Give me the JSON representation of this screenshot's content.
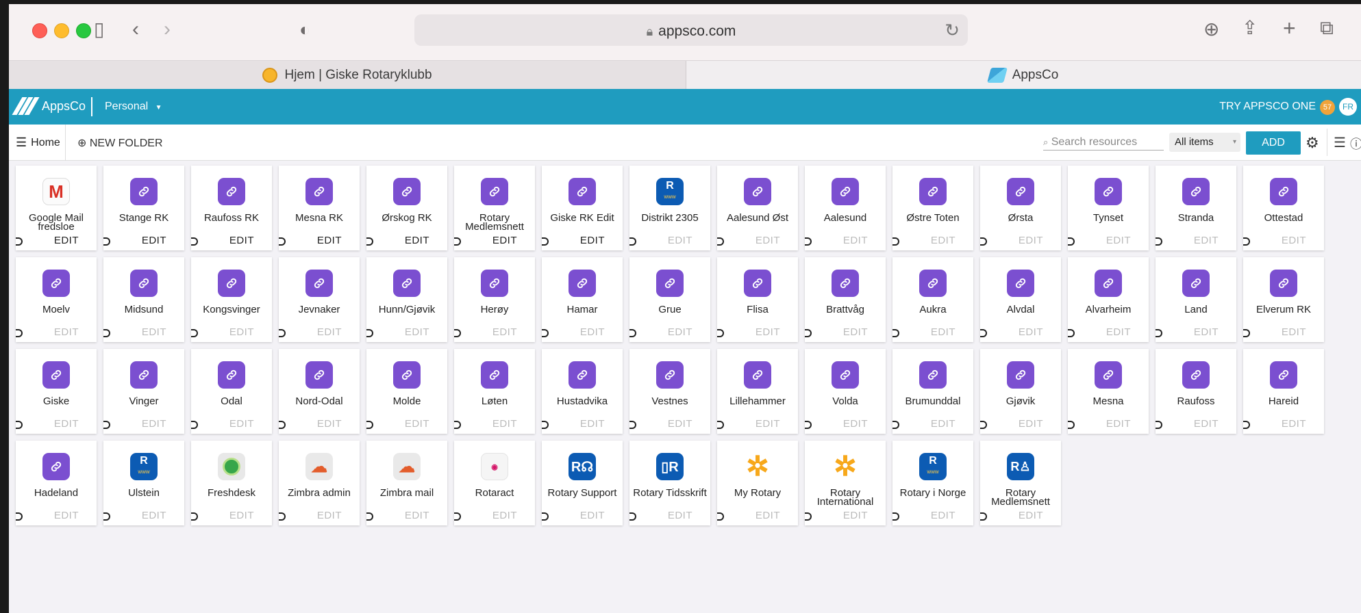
{
  "browser": {
    "url": "appsco.com",
    "tabs": [
      {
        "label": "Hjem | Giske Rotaryklubb"
      },
      {
        "label": "AppsCo"
      }
    ]
  },
  "header": {
    "logo_text": "AppsCo",
    "workspace": "Personal",
    "try_label": "TRY APPSCO ONE",
    "notification_count": "57",
    "avatar_initials": "FR",
    "brand_color": "#1f9cbf"
  },
  "toolbar": {
    "home_label": "Home",
    "new_folder_label": "NEW FOLDER",
    "search_placeholder": "Search resources",
    "filter_value": "All items",
    "add_label": "ADD"
  },
  "resources": [
    {
      "name": "Google Mail fredsloe",
      "icon": "gmail",
      "edit": "EDIT",
      "editable": true
    },
    {
      "name": "Stange RK",
      "icon": "link",
      "edit": "EDIT",
      "editable": true
    },
    {
      "name": "Raufoss RK",
      "icon": "link",
      "edit": "EDIT",
      "editable": true
    },
    {
      "name": "Mesna RK",
      "icon": "link",
      "edit": "EDIT",
      "editable": true
    },
    {
      "name": "Ørskog RK",
      "icon": "link",
      "edit": "EDIT",
      "editable": true
    },
    {
      "name": "Rotary Medlemsnett",
      "icon": "link",
      "edit": "EDIT",
      "editable": true
    },
    {
      "name": "Giske RK Edit",
      "icon": "link",
      "edit": "EDIT",
      "editable": true
    },
    {
      "name": "Distrikt 2305",
      "icon": "rwww",
      "edit": "EDIT",
      "editable": false
    },
    {
      "name": "Aalesund Øst",
      "icon": "link",
      "edit": "EDIT",
      "editable": false
    },
    {
      "name": "Aalesund",
      "icon": "link",
      "edit": "EDIT",
      "editable": false
    },
    {
      "name": "Østre Toten",
      "icon": "link",
      "edit": "EDIT",
      "editable": false
    },
    {
      "name": "Ørsta",
      "icon": "link",
      "edit": "EDIT",
      "editable": false
    },
    {
      "name": "Tynset",
      "icon": "link",
      "edit": "EDIT",
      "editable": false
    },
    {
      "name": "Stranda",
      "icon": "link",
      "edit": "EDIT",
      "editable": false
    },
    {
      "name": "Ottestad",
      "icon": "link",
      "edit": "EDIT",
      "editable": false
    },
    {
      "name": "Moelv",
      "icon": "link",
      "edit": "EDIT",
      "editable": false
    },
    {
      "name": "Midsund",
      "icon": "link",
      "edit": "EDIT",
      "editable": false
    },
    {
      "name": "Kongsvinger",
      "icon": "link",
      "edit": "EDIT",
      "editable": false
    },
    {
      "name": "Jevnaker",
      "icon": "link",
      "edit": "EDIT",
      "editable": false
    },
    {
      "name": "Hunn/Gjøvik",
      "icon": "link",
      "edit": "EDIT",
      "editable": false
    },
    {
      "name": "Herøy",
      "icon": "link",
      "edit": "EDIT",
      "editable": false
    },
    {
      "name": "Hamar",
      "icon": "link",
      "edit": "EDIT",
      "editable": false
    },
    {
      "name": "Grue",
      "icon": "link",
      "edit": "EDIT",
      "editable": false
    },
    {
      "name": "Flisa",
      "icon": "link",
      "edit": "EDIT",
      "editable": false
    },
    {
      "name": "Brattvåg",
      "icon": "link",
      "edit": "EDIT",
      "editable": false
    },
    {
      "name": "Aukra",
      "icon": "link",
      "edit": "EDIT",
      "editable": false
    },
    {
      "name": "Alvdal",
      "icon": "link",
      "edit": "EDIT",
      "editable": false
    },
    {
      "name": "Alvarheim",
      "icon": "link",
      "edit": "EDIT",
      "editable": false
    },
    {
      "name": "Land",
      "icon": "link",
      "edit": "EDIT",
      "editable": false
    },
    {
      "name": "Elverum RK",
      "icon": "link",
      "edit": "EDIT",
      "editable": false
    },
    {
      "name": "Giske",
      "icon": "link",
      "edit": "EDIT",
      "editable": false
    },
    {
      "name": "Vinger",
      "icon": "link",
      "edit": "EDIT",
      "editable": false
    },
    {
      "name": "Odal",
      "icon": "link",
      "edit": "EDIT",
      "editable": false
    },
    {
      "name": "Nord-Odal",
      "icon": "link",
      "edit": "EDIT",
      "editable": false
    },
    {
      "name": "Molde",
      "icon": "link",
      "edit": "EDIT",
      "editable": false
    },
    {
      "name": "Løten",
      "icon": "link",
      "edit": "EDIT",
      "editable": false
    },
    {
      "name": "Hustadvika",
      "icon": "link",
      "edit": "EDIT",
      "editable": false
    },
    {
      "name": "Vestnes",
      "icon": "link",
      "edit": "EDIT",
      "editable": false
    },
    {
      "name": "Lillehammer",
      "icon": "link",
      "edit": "EDIT",
      "editable": false
    },
    {
      "name": "Volda",
      "icon": "link",
      "edit": "EDIT",
      "editable": false
    },
    {
      "name": "Brumunddal",
      "icon": "link",
      "edit": "EDIT",
      "editable": false
    },
    {
      "name": "Gjøvik",
      "icon": "link",
      "edit": "EDIT",
      "editable": false
    },
    {
      "name": "Mesna",
      "icon": "link",
      "edit": "EDIT",
      "editable": false
    },
    {
      "name": "Raufoss",
      "icon": "link",
      "edit": "EDIT",
      "editable": false
    },
    {
      "name": "Hareid",
      "icon": "link",
      "edit": "EDIT",
      "editable": false
    },
    {
      "name": "Hadeland",
      "icon": "link",
      "edit": "EDIT",
      "editable": false
    },
    {
      "name": "Ulstein",
      "icon": "rwww",
      "edit": "EDIT",
      "editable": false
    },
    {
      "name": "Freshdesk",
      "icon": "freshdesk",
      "edit": "EDIT",
      "editable": false
    },
    {
      "name": "Zimbra admin",
      "icon": "zimbra",
      "edit": "EDIT",
      "editable": false
    },
    {
      "name": "Zimbra mail",
      "icon": "zimbra",
      "edit": "EDIT",
      "editable": false
    },
    {
      "name": "Rotaract",
      "icon": "rotaract",
      "edit": "EDIT",
      "editable": false
    },
    {
      "name": "Rotary Support",
      "icon": "rsupport",
      "edit": "EDIT",
      "editable": false
    },
    {
      "name": "Rotary Tidsskrift",
      "icon": "rtid",
      "edit": "EDIT",
      "editable": false
    },
    {
      "name": "My Rotary",
      "icon": "wheel",
      "edit": "EDIT",
      "editable": false
    },
    {
      "name": "Rotary International",
      "icon": "wheel",
      "edit": "EDIT",
      "editable": false
    },
    {
      "name": "Rotary i Norge",
      "icon": "rwww",
      "edit": "EDIT",
      "editable": false
    },
    {
      "name": "Rotary Medlemsnett",
      "icon": "rmed",
      "edit": "EDIT",
      "editable": false
    }
  ]
}
